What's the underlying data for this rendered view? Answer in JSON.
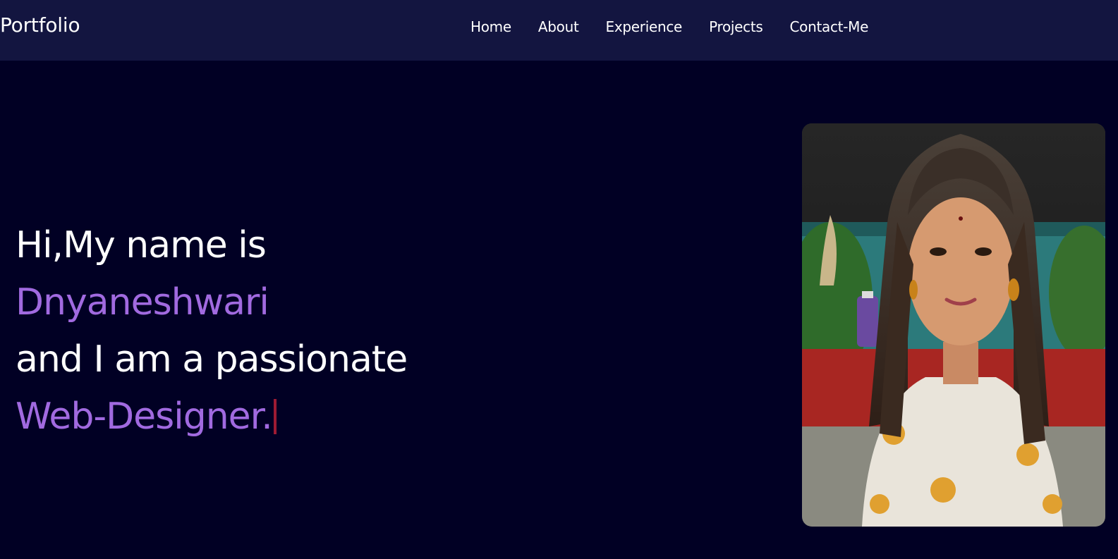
{
  "header": {
    "logo": "Portfolio",
    "nav": [
      {
        "label": "Home"
      },
      {
        "label": "About"
      },
      {
        "label": "Experience"
      },
      {
        "label": "Projects"
      },
      {
        "label": "Contact-Me"
      }
    ]
  },
  "hero": {
    "line1": "Hi,My name is",
    "name": "Dnyaneshwari",
    "line3": "and I am a passionate",
    "role": "Web-Designer.",
    "accent_color": "#a16ae0",
    "cursor_color": "#9e1b33"
  },
  "photo": {
    "subject": "profile-photo"
  },
  "colors": {
    "page_background": "#010024",
    "navbar_background": "#131540",
    "text": "#ffffff"
  }
}
